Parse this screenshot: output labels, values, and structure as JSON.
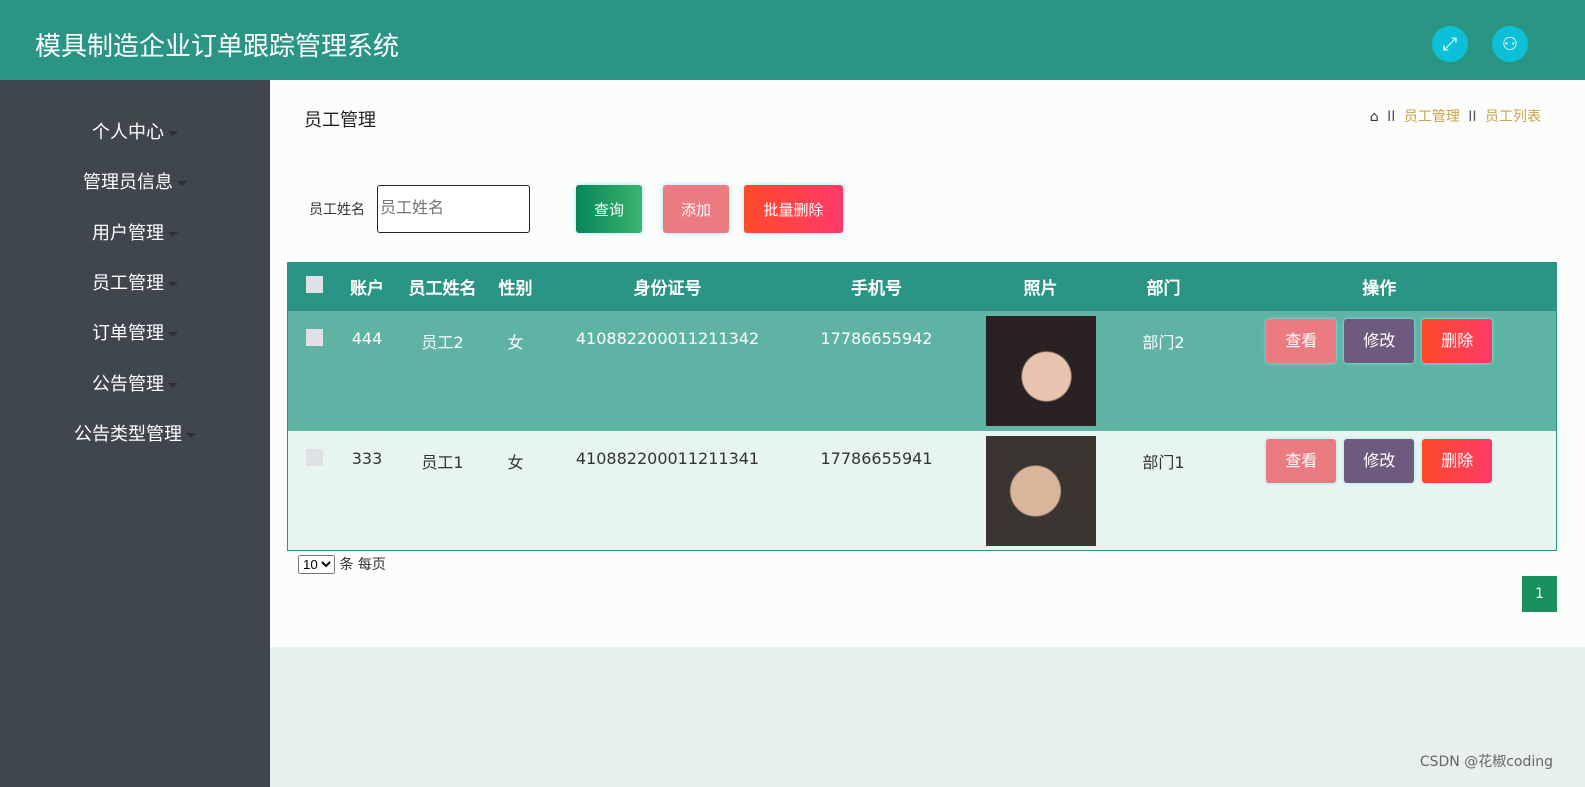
{
  "header": {
    "title": "模具制造企业订单跟踪管理系统",
    "fullscreen_icon": "expand-icon",
    "user_icon": "user-icon"
  },
  "sidebar": {
    "items": [
      {
        "label": "个人中心"
      },
      {
        "label": "管理员信息"
      },
      {
        "label": "用户管理"
      },
      {
        "label": "员工管理"
      },
      {
        "label": "订单管理"
      },
      {
        "label": "公告管理"
      },
      {
        "label": "公告类型管理"
      }
    ]
  },
  "page": {
    "title": "员工管理",
    "breadcrumb": [
      "员工管理",
      "员工列表"
    ],
    "breadcrumb_sep": "II"
  },
  "search": {
    "label": "员工姓名",
    "placeholder": "员工姓名",
    "value": ""
  },
  "toolbar": {
    "query": "查询",
    "add": "添加",
    "batch_delete": "批量删除"
  },
  "table": {
    "headers": [
      "账户",
      "员工姓名",
      "性别",
      "身份证号",
      "手机号",
      "照片",
      "部门",
      "操作"
    ],
    "rows": [
      {
        "account": "444",
        "name": "员工2",
        "gender": "女",
        "id_number": "410882200011211342",
        "phone": "17786655942",
        "department": "部门2"
      },
      {
        "account": "333",
        "name": "员工1",
        "gender": "女",
        "id_number": "410882200011211341",
        "phone": "17786655941",
        "department": "部门1"
      }
    ],
    "actions": {
      "view": "查看",
      "edit": "修改",
      "delete": "删除"
    }
  },
  "pagination": {
    "page_size": "10",
    "per_page_label": "条 每页",
    "current_page": "1"
  },
  "watermark": "CSDN @花椒coding",
  "colors": {
    "header": "#2a9485",
    "sidebar": "#3f464d",
    "view": "#eb7a81",
    "edit": "#6e5a7e",
    "delete": "#ff4136"
  }
}
